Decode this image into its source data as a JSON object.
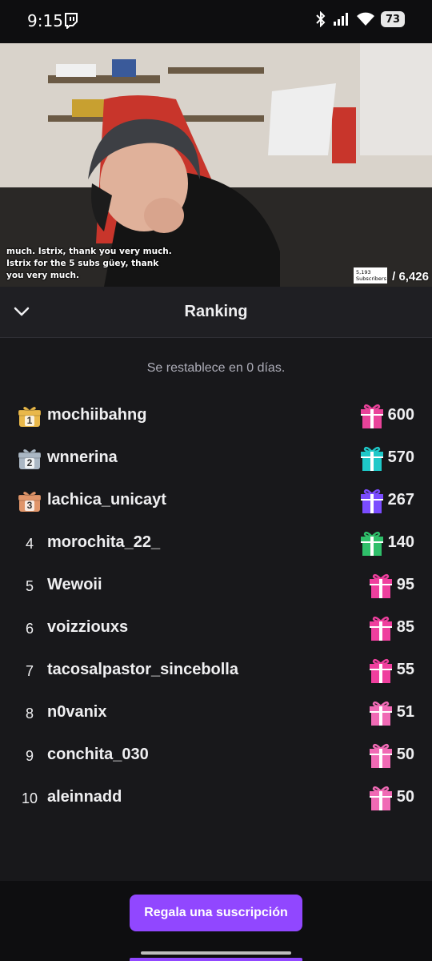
{
  "status_bar": {
    "time": "9:15",
    "battery": "73",
    "icons": [
      "twitch-notification-icon",
      "bluetooth-icon",
      "signal-icon",
      "wifi-icon",
      "battery-icon"
    ]
  },
  "video": {
    "caption": "much. Istrix, thank you very much. Istrix for the 5 subs güey, thank you very much.",
    "subs_count": "5,193",
    "subs_label": "Subscribers",
    "subs_goal": "/ 6,426"
  },
  "panel": {
    "title": "Ranking",
    "reset_text": "Se restablece en 0 días."
  },
  "ranking": [
    {
      "rank": "1",
      "badge": "gold",
      "name": "mochiibahng",
      "count": "600",
      "gift_color": "#e9439a"
    },
    {
      "rank": "2",
      "badge": "silver",
      "name": "wnnerina",
      "count": "570",
      "gift_color": "#1ec8c8"
    },
    {
      "rank": "3",
      "badge": "bronze",
      "name": "lachica_unicayt",
      "count": "267",
      "gift_color": "#7a4cff"
    },
    {
      "rank": "4",
      "badge": "",
      "name": "morochita_22_",
      "count": "140",
      "gift_color": "#2fbf6a"
    },
    {
      "rank": "5",
      "badge": "",
      "name": "Wewoii",
      "count": "95",
      "gift_color": "#ef3f9e"
    },
    {
      "rank": "6",
      "badge": "",
      "name": "voizziouxs",
      "count": "85",
      "gift_color": "#ef3f9e"
    },
    {
      "rank": "7",
      "badge": "",
      "name": "tacosalpastor_sincebolla",
      "count": "55",
      "gift_color": "#ef3f9e"
    },
    {
      "rank": "8",
      "badge": "",
      "name": "n0vanix",
      "count": "51",
      "gift_color": "#f06ab5"
    },
    {
      "rank": "9",
      "badge": "",
      "name": "conchita_030",
      "count": "50",
      "gift_color": "#f06ab5"
    },
    {
      "rank": "10",
      "badge": "",
      "name": "aleinnadd",
      "count": "50",
      "gift_color": "#f06ab5"
    }
  ],
  "cta": {
    "label": "Regala una suscripción"
  },
  "colors": {
    "accent": "#9147ff",
    "gold": "#e9b84a",
    "silver": "#aab7c4",
    "bronze": "#e0956a"
  }
}
